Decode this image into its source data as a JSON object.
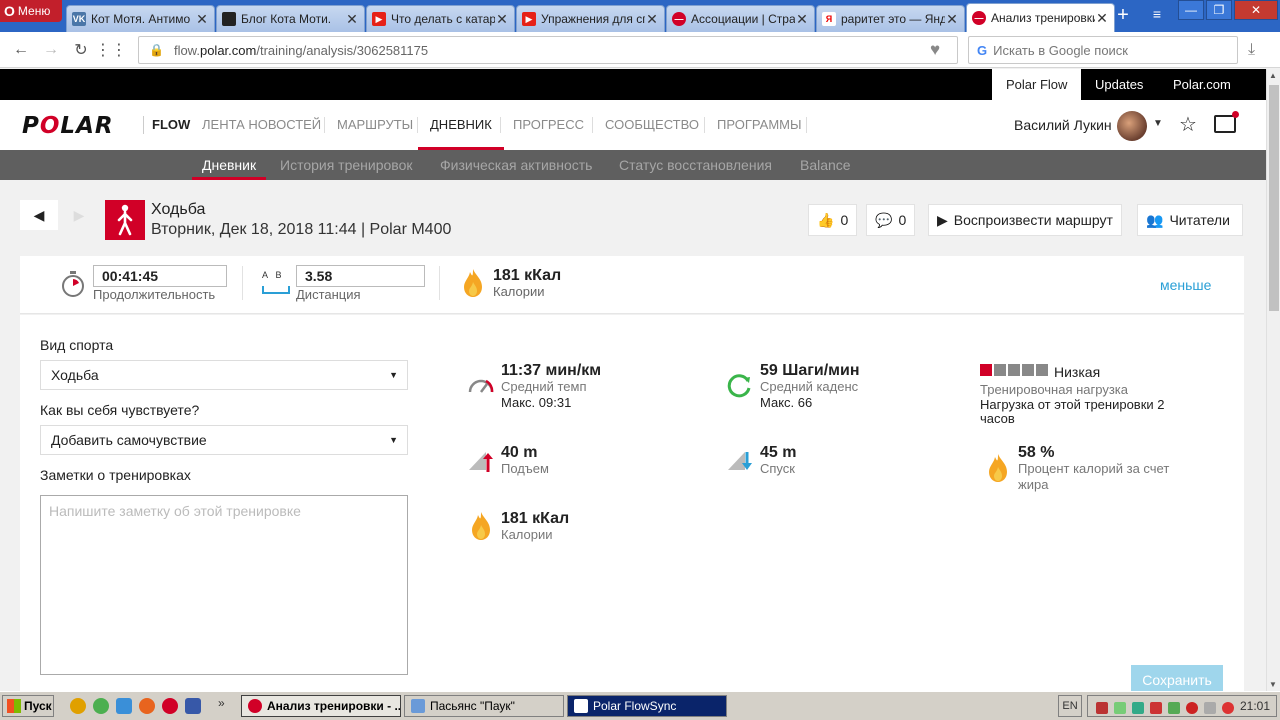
{
  "browser": {
    "menu_label": "Меню",
    "tabs": [
      {
        "title": "Кот Мотя. Антимо",
        "fav_color": "#4a76a8",
        "fav_text": "VK"
      },
      {
        "title": "Блог Кота Моти.",
        "fav_color": "#222222",
        "fav_text": ""
      },
      {
        "title": "Что делать с катар",
        "fav_color": "#e62117",
        "fav_text": "▶"
      },
      {
        "title": "Упражнения для сп",
        "fav_color": "#e62117",
        "fav_text": "▶"
      },
      {
        "title": "Ассоциации | Стра",
        "fav_color": "#d10027",
        "fav_text": "—"
      },
      {
        "title": "раритет это — Янд",
        "fav_color": "#ffffff",
        "fav_text": "Я"
      },
      {
        "title": "Анализ тренировки",
        "fav_color": "#d10027",
        "fav_text": "—"
      }
    ],
    "url_prefix": "flow.",
    "url_domain": "polar.com",
    "url_path": "/training/analysis/3062581175",
    "search_placeholder": "Искать в Google поиск"
  },
  "polar": {
    "top_links": [
      "Polar Flow",
      "Updates",
      "Polar.com"
    ],
    "logo": "POLAR",
    "flow_label": "FLOW",
    "nav": [
      "ЛЕНТА НОВОСТЕЙ",
      "МАРШРУТЫ",
      "ДНЕВНИК",
      "ПРОГРЕСС",
      "СООБЩЕСТВО",
      "ПРОГРАММЫ"
    ],
    "user_name": "Василий Лукин",
    "subnav": [
      "Дневник",
      "История тренировок",
      "Физическая активность",
      "Статус восстановления",
      "Balance"
    ]
  },
  "session": {
    "sport": "Ходьба",
    "date_line": "Вторник, Дек 18, 2018 11:44 | Polar M400",
    "likes": "0",
    "comments": "0",
    "replay_label": "Воспроизвести маршрут",
    "readers_label": "Читатели"
  },
  "summary": {
    "duration": "00:41:45",
    "duration_label": "Продолжительность",
    "ab_a": "A",
    "ab_b": "B",
    "distance": "3.58",
    "distance_label": "Дистанция",
    "calories": "181 кКал",
    "calories_label": "Калории",
    "less_label": "меньше"
  },
  "form": {
    "sport_label": "Вид спорта",
    "sport_value": "Ходьба",
    "feeling_label": "Как вы себя чувствуете?",
    "feeling_value": "Добавить самочувствие",
    "notes_label": "Заметки о тренировках",
    "notes_placeholder": "Напишите заметку об этой тренировке",
    "save_label": "Сохранить"
  },
  "stats": {
    "pace": {
      "value": "11:37 мин/км",
      "label": "Средний темп",
      "max": "Макс. 09:31"
    },
    "cadence": {
      "value": "59 Шаги/мин",
      "label": "Средний каденс",
      "max": "Макс. 66"
    },
    "load": {
      "value": "Низкая",
      "label": "Тренировочная нагрузка",
      "detail": "Нагрузка от этой тренировки 2 часов",
      "level": 1,
      "max_level": 5
    },
    "ascent": {
      "value": "40 m",
      "label": "Подъем"
    },
    "descent": {
      "value": "45 m",
      "label": "Спуск"
    },
    "fat": {
      "value": "58 %",
      "label": "Процент калорий за счет жира"
    },
    "calories": {
      "value": "181 кКал",
      "label": "Калории"
    }
  },
  "taskbar": {
    "start_label": "Пуск",
    "windows": [
      "Анализ тренировки - ...",
      "Пасьянс \"Паук\"",
      "Polar FlowSync"
    ],
    "lang": "EN",
    "clock": "21:01"
  },
  "colors": {
    "polar_red": "#d10027",
    "link_blue": "#2a9fd6",
    "browser_blue": "#2c66c4"
  }
}
